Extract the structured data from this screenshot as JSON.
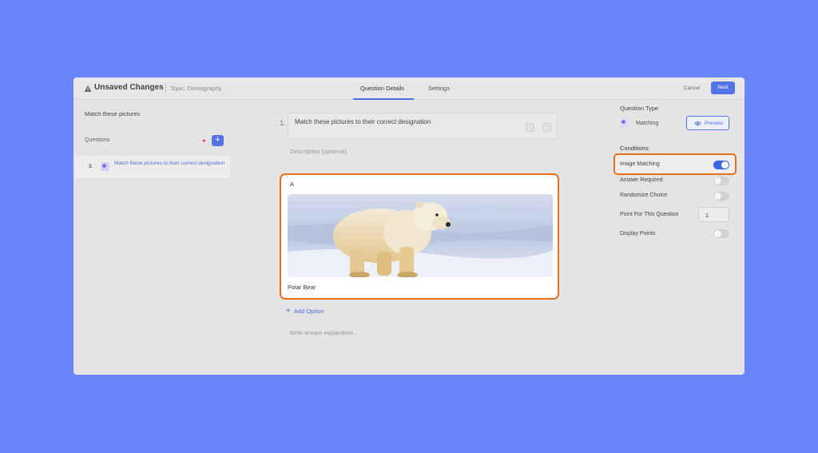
{
  "header": {
    "title": "Unsaved Changes",
    "topic": "Topic: Demography",
    "tabs": [
      "Question Details",
      "Settings"
    ],
    "cancel_label": "Cancel",
    "next_label": "Next"
  },
  "sidebar": {
    "title": "Match these pictures",
    "questions_label": "Questions",
    "add_label": "+",
    "items": [
      {
        "number": "1",
        "text": "Match these pictures to their correct designation"
      }
    ]
  },
  "question": {
    "number": "1.",
    "text": "Match these pictures to their correct designation",
    "description_placeholder": "Description (optional)",
    "options": [
      {
        "letter": "A",
        "label": "Polar Bear",
        "image": "polar-bear-photo"
      }
    ],
    "add_option_label": "Add Option",
    "explanation_placeholder": "Write answer explanation..."
  },
  "settings": {
    "question_type_label": "Question Type",
    "question_type_value": "Matching",
    "preview_label": "Preview",
    "conditions_label": "Conditions:",
    "toggles": [
      {
        "label": "Image Matching",
        "on": true
      },
      {
        "label": "Answer Required",
        "on": false
      },
      {
        "label": "Randomize Choice",
        "on": false
      }
    ],
    "points_label": "Point For This Question",
    "points_value": "1",
    "display_points": {
      "label": "Display Points",
      "on": false
    }
  },
  "colors": {
    "background": "#6a85fb",
    "accent": "#5574e3",
    "highlight": "#e5711f"
  }
}
